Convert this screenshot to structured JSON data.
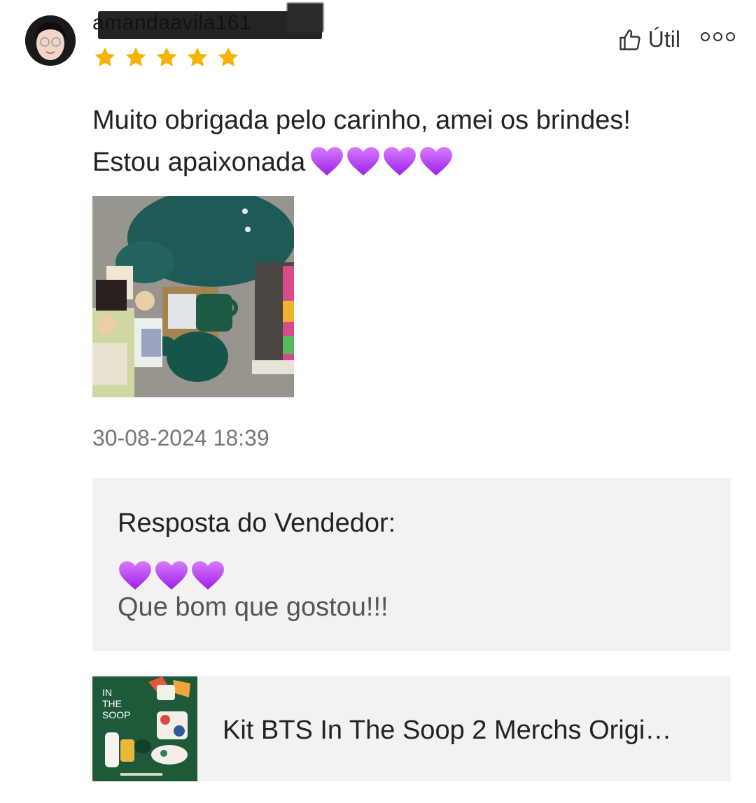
{
  "review": {
    "username": "amandaavila161",
    "rating": 5,
    "helpful_label": "Útil",
    "text_line1": "Muito obrigada pelo carinho, amei os brindes!",
    "text_line2": "Estou apaixonada",
    "text_emoji_count": 4,
    "date": "30-08-2024 18:39"
  },
  "seller_reply": {
    "title": "Resposta do Vendedor:",
    "emoji_count": 3,
    "text": "Que bom que gostou!!!"
  },
  "product": {
    "name": "Kit BTS In The Soop 2 Merchs Origi…",
    "thumb_text_line1": "IN",
    "thumb_text_line2": "THE",
    "thumb_text_line3": "SOOP"
  },
  "colors": {
    "star": "#F5B400",
    "heart": "#B23AF2",
    "reply_bg": "#F2F2F2"
  },
  "icons": {
    "helpful": "thumbs-up-icon",
    "more": "more-options-icon",
    "star": "star-icon",
    "heart": "purple-heart-icon"
  }
}
